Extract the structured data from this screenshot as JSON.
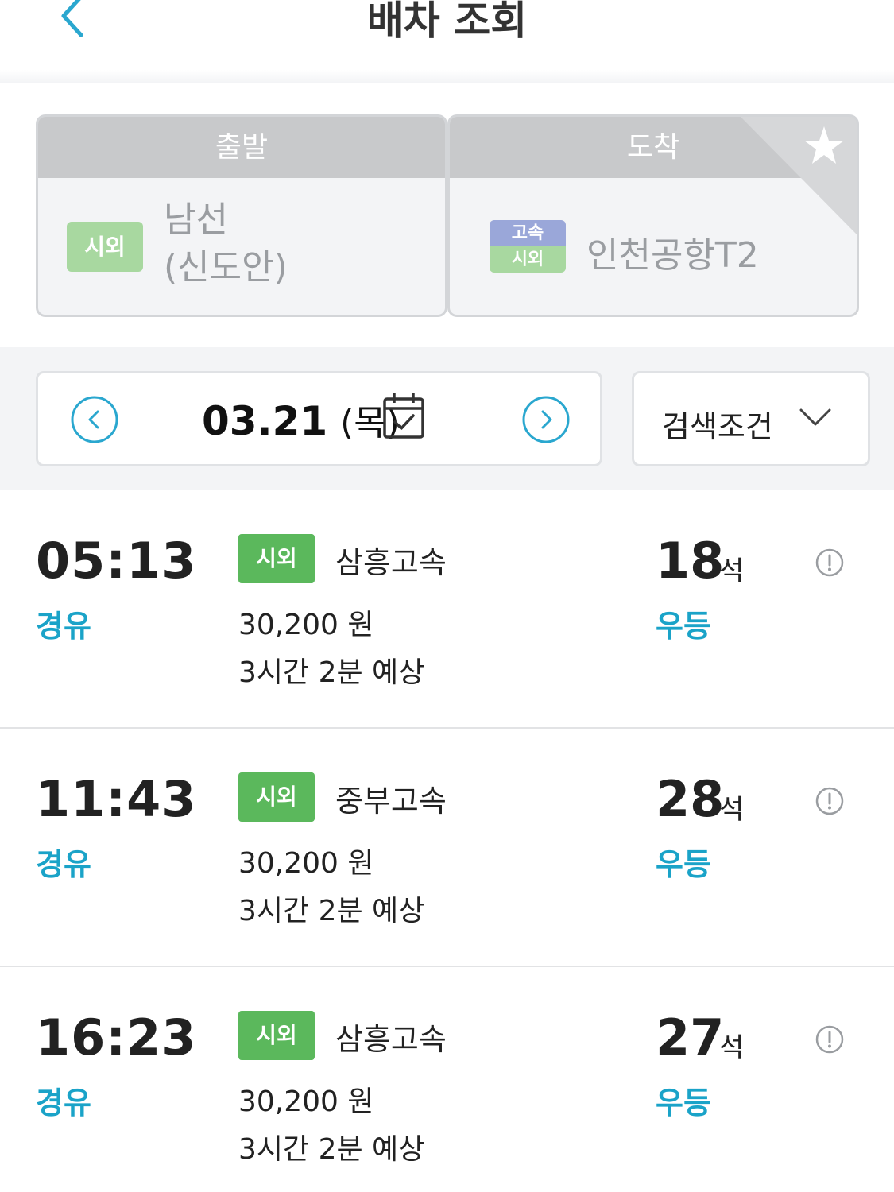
{
  "header": {
    "title": "배차 조회",
    "back_icon": "chevron-left-icon"
  },
  "route": {
    "departure_header": "출발",
    "departure_badge": "시외",
    "departure_name_line1": "남선",
    "departure_name_line2": "(신도안)",
    "arrival_header": "도착",
    "arrival_badge_top": "고속",
    "arrival_badge_bottom": "시외",
    "arrival_name": "인천공항T2",
    "favorite_icon": "star-icon"
  },
  "date": {
    "value": "03.21",
    "weekday": "(목)",
    "prev_icon": "chevron-left-circle-icon",
    "next_icon": "chevron-right-circle-icon",
    "calendar_icon": "calendar-check-icon"
  },
  "filter": {
    "label": "검색조건",
    "icon": "chevron-down-icon"
  },
  "colors": {
    "accent": "#1aa3c8",
    "badge_green": "#5bb85c",
    "badge_light_green": "#a8d8a0",
    "badge_blue": "#9aa7d9"
  },
  "schedules": [
    {
      "time": "05:13",
      "via": "경유",
      "badge": "시외",
      "company": "삼흥고속",
      "price": "30,200 원",
      "duration": "3시간 2분 예상",
      "seats": "18",
      "seats_unit": "석",
      "grade": "우등"
    },
    {
      "time": "11:43",
      "via": "경유",
      "badge": "시외",
      "company": "중부고속",
      "price": "30,200 원",
      "duration": "3시간 2분 예상",
      "seats": "28",
      "seats_unit": "석",
      "grade": "우등"
    },
    {
      "time": "16:23",
      "via": "경유",
      "badge": "시외",
      "company": "삼흥고속",
      "price": "30,200 원",
      "duration": "3시간 2분 예상",
      "seats": "27",
      "seats_unit": "석",
      "grade": "우등"
    }
  ]
}
